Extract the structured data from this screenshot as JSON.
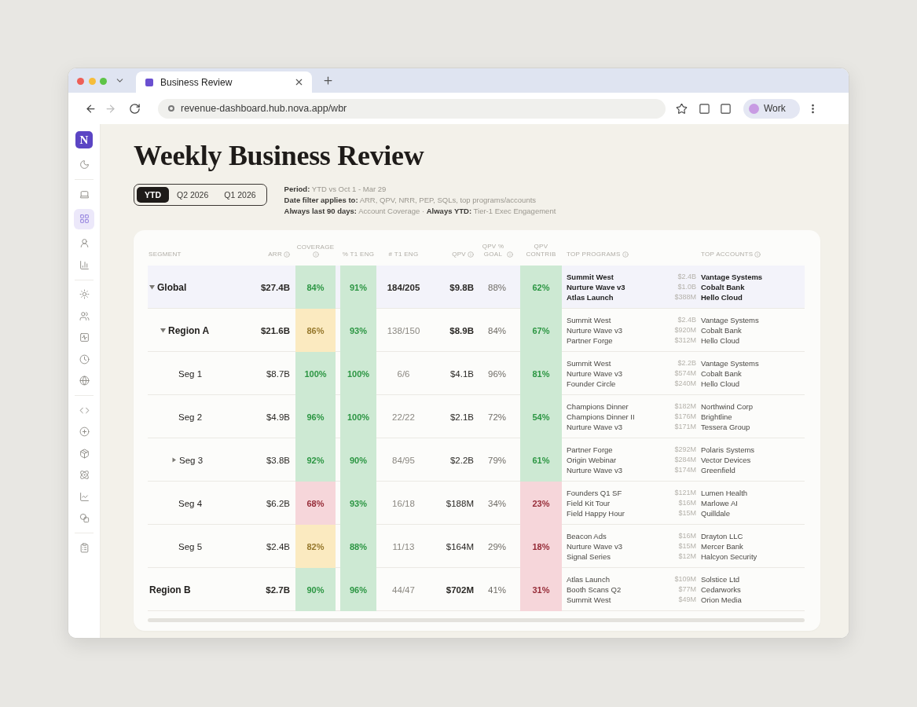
{
  "browser": {
    "tab_title": "Business Review",
    "url": "revenue-dashboard.hub.nova.app/wbr",
    "back_disabled": false,
    "forward_disabled": true,
    "profile": "Work"
  },
  "sidebar": {
    "logo": "N",
    "groups": [
      {
        "items": [
          {
            "selected": false
          }
        ]
      },
      {
        "items": [
          {
            "selected": false
          },
          {
            "selected": true
          },
          {
            "selected": false
          },
          {
            "selected": false
          }
        ]
      },
      {
        "items": [
          {
            "selected": false
          },
          {
            "selected": false
          },
          {
            "selected": false
          },
          {
            "selected": false
          },
          {
            "selected": false
          }
        ]
      },
      {
        "items": [
          {
            "selected": false
          },
          {
            "selected": false
          },
          {
            "selected": false
          },
          {
            "selected": false
          },
          {
            "selected": false
          },
          {
            "selected": false
          }
        ]
      },
      {
        "items": [
          {
            "selected": false
          }
        ]
      }
    ]
  },
  "page": {
    "title": "Weekly Business Review",
    "period_tabs": [
      {
        "label": "YTD",
        "selected": true
      },
      {
        "label": "Q2 2026",
        "selected": false
      },
      {
        "label": "Q1 2026",
        "selected": false
      }
    ],
    "notes": [
      "**Period:** YTD vs Oct 1 - Mar 29",
      "**Date filter applies to:** ARR, QPV, NRR, PEP, SQLs, top programs/accounts",
      "**Always last 90 days:** Account Coverage · **Always YTD:** Tier-1 Exec Engagement"
    ]
  },
  "table": {
    "columns": [
      {
        "label": "SEGMENT",
        "info": false
      },
      {
        "label": "ARR",
        "info": true
      },
      {
        "label": "COVERAGE",
        "info": true
      },
      {
        "label": "% T1 ENG",
        "info": false
      },
      {
        "label": "# T1 ENG",
        "info": false
      },
      {
        "label": "QPV",
        "info": true
      },
      {
        "label": "QPV % GOAL",
        "info": true
      },
      {
        "label": "QPV CONTRIB",
        "info": false
      },
      {
        "label": "TOP PROGRAMS",
        "info": true
      },
      {
        "label": "TOP ACCOUNTS",
        "info": true
      }
    ],
    "rows": [
      {
        "segment": "Global",
        "kind": "total",
        "expanded": true,
        "arr": "$27.4B",
        "coverage": {
          "value": "84%",
          "color": "#cde9d3"
        },
        "t1_eng_pct": {
          "value": "91%",
          "color": "#cde9d3"
        },
        "t1_eng_count": "184/205",
        "qpv": "$9.8B",
        "qpv_pct_goal": "88%",
        "qpv_contrib": {
          "value": "62%",
          "color": "#cde9d3"
        },
        "top_programs": [
          "Summit West",
          "Nurture Wave v3",
          "Atlas Launch"
        ],
        "top_accounts": [
          {
            "amount": "$2.4B",
            "name": "Vantage Systems"
          },
          {
            "amount": "$1.0B",
            "name": "Cobalt Bank"
          },
          {
            "amount": "$388M",
            "name": "Hello Cloud"
          }
        ],
        "children": [
          {
            "segment": "Region A",
            "kind": "region",
            "expanded": true,
            "arr": "$21.6B",
            "coverage": {
              "value": "86%",
              "color": "#fbeac0"
            },
            "t1_eng_pct": {
              "value": "93%",
              "color": "#cde9d3"
            },
            "t1_eng_count": "138/150",
            "qpv": "$8.9B",
            "qpv_pct_goal": "84%",
            "qpv_contrib": {
              "value": "67%",
              "color": "#cde9d3"
            },
            "top_programs": [
              "Summit West",
              "Nurture Wave v3",
              "Partner Forge"
            ],
            "top_accounts": [
              {
                "amount": "$2.4B",
                "name": "Vantage Systems"
              },
              {
                "amount": "$920M",
                "name": "Cobalt Bank"
              },
              {
                "amount": "$312M",
                "name": "Hello Cloud"
              }
            ],
            "children": [
              {
                "segment": "Seg 1",
                "kind": "segment",
                "arr": "$8.7B",
                "coverage": {
                  "value": "100%",
                  "color": "#cde9d3"
                },
                "t1_eng_pct": {
                  "value": "100%",
                  "color": "#cde9d3"
                },
                "t1_eng_count": "6/6",
                "qpv": "$4.1B",
                "qpv_pct_goal": "96%",
                "qpv_contrib": {
                  "value": "81%",
                  "color": "#cde9d3"
                },
                "top_programs": [
                  "Summit West",
                  "Nurture Wave v3",
                  "Founder Circle"
                ],
                "top_accounts": [
                  {
                    "amount": "$2.2B",
                    "name": "Vantage Systems"
                  },
                  {
                    "amount": "$574M",
                    "name": "Cobalt Bank"
                  },
                  {
                    "amount": "$240M",
                    "name": "Hello Cloud"
                  }
                ]
              },
              {
                "segment": "Seg 2",
                "kind": "segment",
                "arr": "$4.9B",
                "coverage": {
                  "value": "96%",
                  "color": "#cde9d3"
                },
                "t1_eng_pct": {
                  "value": "100%",
                  "color": "#cde9d3"
                },
                "t1_eng_count": "22/22",
                "qpv": "$2.1B",
                "qpv_pct_goal": "72%",
                "qpv_contrib": {
                  "value": "54%",
                  "color": "#cde9d3"
                },
                "top_programs": [
                  "Champions Dinner",
                  "Champions Dinner II",
                  "Nurture Wave v3"
                ],
                "top_accounts": [
                  {
                    "amount": "$182M",
                    "name": "Northwind Corp"
                  },
                  {
                    "amount": "$176M",
                    "name": "Brightline"
                  },
                  {
                    "amount": "$171M",
                    "name": "Tessera Group"
                  }
                ]
              },
              {
                "segment": "Seg 3",
                "kind": "segment",
                "expanded": false,
                "arr": "$3.8B",
                "coverage": {
                  "value": "92%",
                  "color": "#cde9d3"
                },
                "t1_eng_pct": {
                  "value": "90%",
                  "color": "#cde9d3"
                },
                "t1_eng_count": "84/95",
                "qpv": "$2.2B",
                "qpv_pct_goal": "79%",
                "qpv_contrib": {
                  "value": "61%",
                  "color": "#cde9d3"
                },
                "top_programs": [
                  "Partner Forge",
                  "Origin Webinar",
                  "Nurture Wave v3"
                ],
                "top_accounts": [
                  {
                    "amount": "$292M",
                    "name": "Polaris Systems"
                  },
                  {
                    "amount": "$284M",
                    "name": "Vector Devices"
                  },
                  {
                    "amount": "$174M",
                    "name": "Greenfield"
                  }
                ]
              },
              {
                "segment": "Seg 4",
                "kind": "segment",
                "arr": "$6.2B",
                "coverage": {
                  "value": "68%",
                  "color": "#f6d6da"
                },
                "t1_eng_pct": {
                  "value": "93%",
                  "color": "#cde9d3"
                },
                "t1_eng_count": "16/18",
                "qpv": "$188M",
                "qpv_pct_goal": "34%",
                "qpv_contrib": {
                  "value": "23%",
                  "color": "#f6d6da"
                },
                "top_programs": [
                  "Founders Q1 SF",
                  "Field Kit Tour",
                  "Field Happy Hour"
                ],
                "top_accounts": [
                  {
                    "amount": "$121M",
                    "name": "Lumen Health"
                  },
                  {
                    "amount": "$16M",
                    "name": "Marlowe AI"
                  },
                  {
                    "amount": "$15M",
                    "name": "Quilldale"
                  }
                ]
              },
              {
                "segment": "Seg 5",
                "kind": "segment",
                "arr": "$2.4B",
                "coverage": {
                  "value": "82%",
                  "color": "#fbeac0"
                },
                "t1_eng_pct": {
                  "value": "88%",
                  "color": "#cde9d3"
                },
                "t1_eng_count": "11/13",
                "qpv": "$164M",
                "qpv_pct_goal": "29%",
                "qpv_contrib": {
                  "value": "18%",
                  "color": "#f6d6da"
                },
                "top_programs": [
                  "Beacon Ads",
                  "Nurture Wave v3",
                  "Signal Series"
                ],
                "top_accounts": [
                  {
                    "amount": "$16M",
                    "name": "Drayton LLC"
                  },
                  {
                    "amount": "$15M",
                    "name": "Mercer Bank"
                  },
                  {
                    "amount": "$12M",
                    "name": "Halcyon Security"
                  }
                ]
              }
            ]
          }
        ]
      },
      {
        "segment": "Region B",
        "kind": "region",
        "arr": "$2.7B",
        "coverage": {
          "value": "90%",
          "color": "#cde9d3"
        },
        "t1_eng_pct": {
          "value": "96%",
          "color": "#cde9d3"
        },
        "t1_eng_count": "44/47",
        "qpv": "$702M",
        "qpv_pct_goal": "41%",
        "qpv_contrib": {
          "value": "31%",
          "color": "#f6d6da"
        },
        "top_programs": [
          "Atlas Launch",
          "Booth Scans Q2",
          "Summit West"
        ],
        "top_accounts": [
          {
            "amount": "$109M",
            "name": "Solstice Ltd"
          },
          {
            "amount": "$77M",
            "name": "Cedarworks"
          },
          {
            "amount": "$49M",
            "name": "Orion Media"
          }
        ]
      }
    ]
  }
}
